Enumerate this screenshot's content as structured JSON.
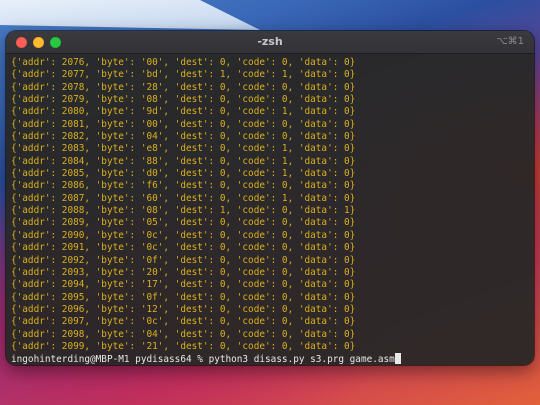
{
  "window": {
    "title": "-zsh",
    "shortcut": "⌥⌘1"
  },
  "terminal": {
    "lines": [
      "{'addr': 2076, 'byte': '00', 'dest': 0, 'code': 0, 'data': 0}",
      "{'addr': 2077, 'byte': 'bd', 'dest': 1, 'code': 1, 'data': 0}",
      "{'addr': 2078, 'byte': '28', 'dest': 0, 'code': 0, 'data': 0}",
      "{'addr': 2079, 'byte': '08', 'dest': 0, 'code': 0, 'data': 0}",
      "{'addr': 2080, 'byte': '9d', 'dest': 0, 'code': 1, 'data': 0}",
      "{'addr': 2081, 'byte': '00', 'dest': 0, 'code': 0, 'data': 0}",
      "{'addr': 2082, 'byte': '04', 'dest': 0, 'code': 0, 'data': 0}",
      "{'addr': 2083, 'byte': 'e8', 'dest': 0, 'code': 1, 'data': 0}",
      "{'addr': 2084, 'byte': '88', 'dest': 0, 'code': 1, 'data': 0}",
      "{'addr': 2085, 'byte': 'd0', 'dest': 0, 'code': 1, 'data': 0}",
      "{'addr': 2086, 'byte': 'f6', 'dest': 0, 'code': 0, 'data': 0}",
      "{'addr': 2087, 'byte': '60', 'dest': 0, 'code': 1, 'data': 0}",
      "{'addr': 2088, 'byte': '08', 'dest': 1, 'code': 0, 'data': 1}",
      "{'addr': 2089, 'byte': '05', 'dest': 0, 'code': 0, 'data': 0}",
      "{'addr': 2090, 'byte': '0c', 'dest': 0, 'code': 0, 'data': 0}",
      "{'addr': 2091, 'byte': '0c', 'dest': 0, 'code': 0, 'data': 0}",
      "{'addr': 2092, 'byte': '0f', 'dest': 0, 'code': 0, 'data': 0}",
      "{'addr': 2093, 'byte': '20', 'dest': 0, 'code': 0, 'data': 0}",
      "{'addr': 2094, 'byte': '17', 'dest': 0, 'code': 0, 'data': 0}",
      "{'addr': 2095, 'byte': '0f', 'dest': 0, 'code': 0, 'data': 0}",
      "{'addr': 2096, 'byte': '12', 'dest': 0, 'code': 0, 'data': 0}",
      "{'addr': 2097, 'byte': '0c', 'dest': 0, 'code': 0, 'data': 0}",
      "{'addr': 2098, 'byte': '04', 'dest': 0, 'code': 0, 'data': 0}",
      "{'addr': 2099, 'byte': '21', 'dest': 0, 'code': 0, 'data': 0}"
    ],
    "prompt": "ingohinterding@MBP-M1 pydisass64 % ",
    "command": "python3 disass.py s3.prg game.asm"
  },
  "colors": {
    "output_text": "#d9b01e",
    "prompt_text": "#e8e8e8"
  }
}
